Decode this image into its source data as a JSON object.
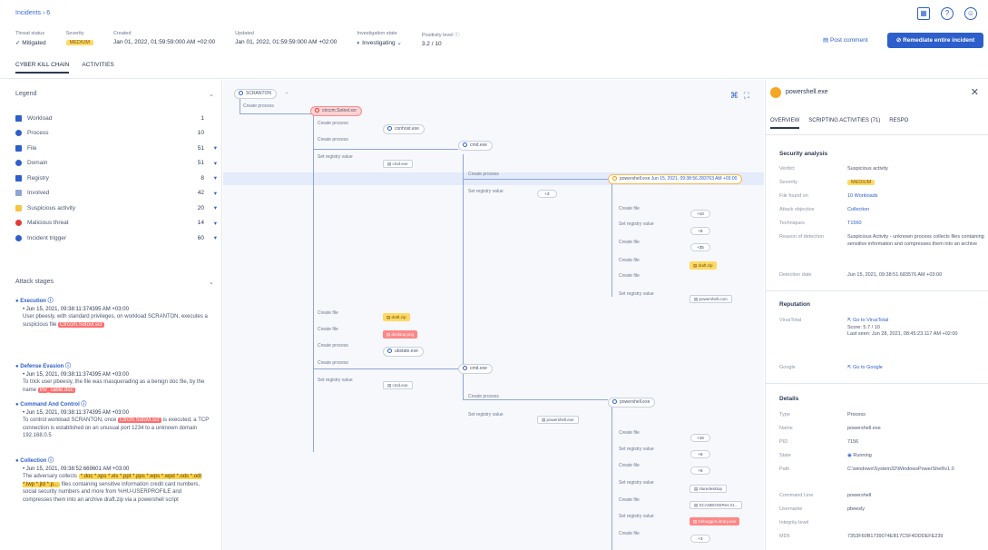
{
  "breadcrumb": "Incidents  ›  6",
  "header": {
    "threat_status_label": "Threat status",
    "threat_status": "Mitigated",
    "severity_label": "Severity",
    "severity": "MEDIUM",
    "created_label": "Created",
    "created": "Jan 01, 2022, 01:59:59:000 AM +02:00",
    "updated_label": "Updated",
    "updated": "Jan 01, 2022, 01:59:59:000 AM +02:00",
    "investigation_label": "Investigation state",
    "investigation": "Investigating",
    "positivity_label": "Positivity level",
    "positivity": "3.2 / 10",
    "post_comment": "Post comment",
    "remediate": "Remediate entire incident"
  },
  "tabs": [
    "CYBER KILL CHAIN",
    "ACTIVITIES"
  ],
  "legend": {
    "title": "Legend",
    "items": [
      {
        "name": "Workload",
        "count": "1",
        "arrow": "",
        "color": "#2d5fcc"
      },
      {
        "name": "Process",
        "count": "10",
        "arrow": "",
        "color": "#2d5fcc"
      },
      {
        "name": "File",
        "count": "51",
        "arrow": "▾",
        "color": "#2d5fcc"
      },
      {
        "name": "Domain",
        "count": "51",
        "arrow": "▾",
        "color": "#2d5fcc"
      },
      {
        "name": "Registry",
        "count": "8",
        "arrow": "▾",
        "color": "#2d5fcc"
      },
      {
        "name": "Involved",
        "count": "42",
        "arrow": "▾",
        "color": "#8ea6d6"
      },
      {
        "name": "Suspicious activity",
        "count": "20",
        "arrow": "▾",
        "color": "#f5c542"
      },
      {
        "name": "Malicious threat",
        "count": "14",
        "arrow": "▾",
        "color": "#e23b3b"
      },
      {
        "name": "Incident trigger",
        "count": "60",
        "arrow": "▾",
        "color": "#2d5fcc"
      }
    ]
  },
  "stages": {
    "title": "Attack stages",
    "items": [
      {
        "name": "Execution",
        "time": "Jun 15, 2021, 09:38:11:374395 AM +03:00",
        "pre": "User pbeesly, with standard privileges, on workload SCRANTON, executes a suspicious file ",
        "tag": "Ctrccm.Sotovl.scr",
        "post": ""
      },
      {
        "name": "Defense Evasion",
        "time": "Jun 15, 2021, 09:38:11:374395 AM +03:00",
        "pre": "To trick user pbeesly, the file was masquerading as a benign doc file, by the name ",
        "tag": "Inv_Table.doc",
        "post": ""
      },
      {
        "name": "Command And Control",
        "time": "Jun 15, 2021, 09:38:11:374395 AM +03:00",
        "pre": "To control workload SCRANTON, once ",
        "tag": "Ctrcm.Sotovl.scr",
        "post": " is executed, a TCP connection is established on an unusual port 1234 to a unknown domain 192.168.0.5"
      },
      {
        "name": "Collection",
        "time": "Jun 15, 2021, 09:38:52:669601 AM +03:00",
        "pre": "The adversary collects ",
        "tag": "*.doc *.xps *.xls *.ppt *.pps *.wps *.wpd *.ods *.odt *.lwp *.jtd *.p...",
        "post": " files containing sensitive information credit card numbers, social security numbers and more from %HU-USERPROFILE and compresses them into an archive  draft.zip  via a powershell script"
      }
    ]
  },
  "graph": {
    "root": "SCRANTON",
    "nodes": {
      "n1": "ctrccm.Sotovl.scr",
      "n2": "conhost.exe",
      "n3": "cmd.exe",
      "n4": "powershell.exe",
      "n4_time": "Jun 15, 2021, 09:38:56.283763 AM +03:00",
      "n5": "cmd.exe",
      "n6": "powershell.exe",
      "file1": "cmd.exe",
      "file2": "draft.zip",
      "file3": "powershell.com",
      "file4": "draft.zip",
      "file5": "desktop.png",
      "file6": "ubstate.exe",
      "file7": "cmd.exe",
      "file8": "powershell.exe",
      "file9": "sluredesktop",
      "file10": "SCANBOXERes.XI...",
      "file11": "DebuggerLibrary.exe"
    },
    "labels": {
      "create_process": "Create process",
      "set_registry": "Set registry value",
      "create_file": "Create file"
    },
    "pills": [
      "+3",
      "+10",
      "+8",
      "+35",
      "+16",
      "+8",
      "+6",
      "+3"
    ]
  },
  "right_panel": {
    "title": "powershell.exe",
    "tabs": [
      "OVERVIEW",
      "SCRIPTING ACTIVITIES (71)",
      "RESPO"
    ],
    "security_title": "Security analysis",
    "verdict_k": "Verdict",
    "verdict": "Suspicious activity",
    "severity_k": "Severity",
    "severity": "MEDIUM",
    "found_k": "File found on",
    "found": "10 Workloads",
    "objective_k": "Attack objective",
    "objective": "Collection",
    "technique_k": "Techniques",
    "technique": "T1560",
    "reason_k": "Reason of detection",
    "reason": "Suspicious Activity - unknown process collects files containing sensitive information and compresses them into an archive",
    "date_k": "Detection date",
    "date": "Jun 15, 2021, 09:38:51.683576 AM +03:00",
    "reputation_title": "Reputation",
    "vt_k": "VirusTotal",
    "vt_link": "Go to VirusTotal",
    "vt_score": "Score: 5.7 / 10",
    "vt_seen": "Last seen: Jun 28, 2021, 08:45:23.117 AM +02:00",
    "google_k": "Google",
    "google_link": "Go to Google",
    "details_title": "Details",
    "type_k": "Type",
    "type": "Process",
    "name_k": "Name",
    "name": "powershell.exe",
    "pid_k": "PID",
    "pid": "7156",
    "state_k": "State",
    "state": "Running",
    "path_k": "Path",
    "path": "C:\\windows\\System32\\WindowsPowerShell\\v1.0",
    "cmd_k": "Command Line",
    "cmd": "powershell",
    "user_k": "Username",
    "user": "pbeesly",
    "integrity_k": "Integrity level",
    "integrity": "",
    "md5_k": "MD5",
    "md5": "7353F60B1739074EB17C5F4DDDEFE239"
  }
}
